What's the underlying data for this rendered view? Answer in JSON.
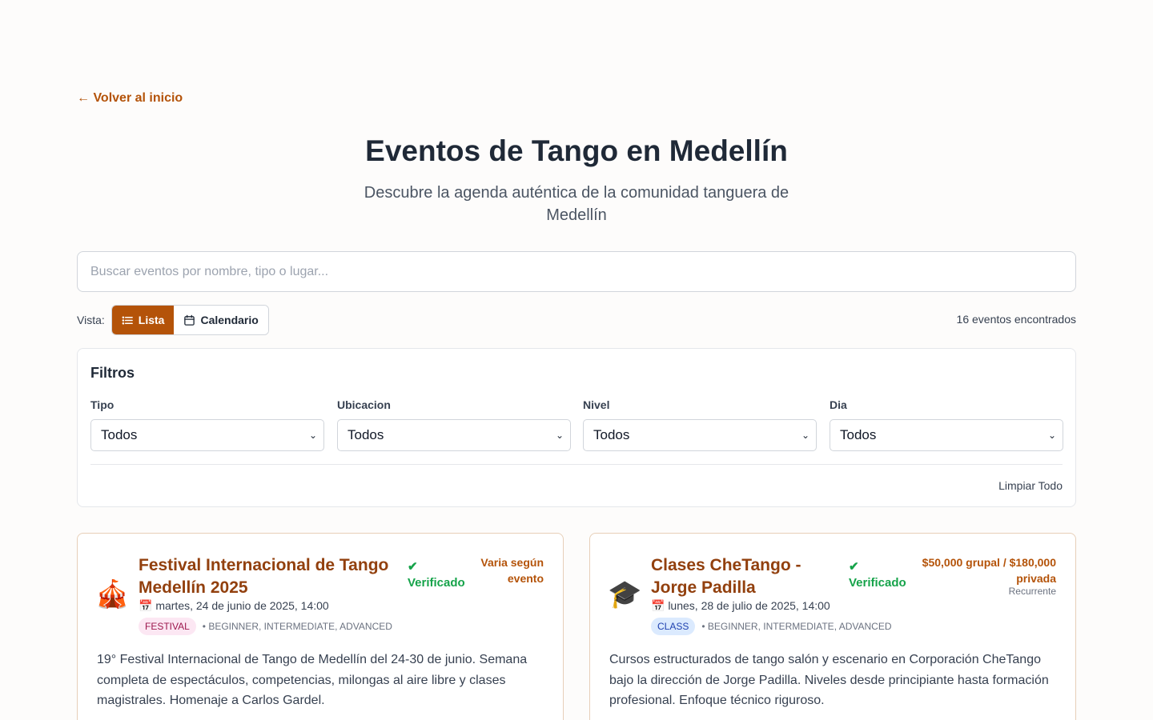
{
  "back_link": "← Volver al inicio",
  "page_title": "Eventos de Tango en Medellín",
  "page_subtitle": "Descubre la agenda auténtica de la comunidad tanguera de Medellín",
  "search": {
    "placeholder": "Buscar eventos por nombre, tipo o lugar..."
  },
  "view": {
    "label": "Vista:",
    "list_label": "Lista",
    "calendar_label": "Calendario",
    "active": "Lista"
  },
  "results_count": "16 eventos encontrados",
  "filters": {
    "title": "Filtros",
    "groups": [
      {
        "label": "Tipo",
        "value": "Todos"
      },
      {
        "label": "Ubicacion",
        "value": "Todos"
      },
      {
        "label": "Nivel",
        "value": "Todos"
      },
      {
        "label": "Dia",
        "value": "Todos"
      }
    ],
    "clear_label": "Limpiar Todo"
  },
  "events": [
    {
      "emoji": "🎪",
      "title": "Festival Internacional de Tango Medellín 2025",
      "verified": "✔ Verificado",
      "price": "Varia según evento",
      "recurrent": "",
      "date": "📅 martes, 24 de junio de 2025, 14:00",
      "type_badge": "FESTIVAL",
      "levels": "• BEGINNER, INTERMEDIATE, ADVANCED",
      "description": "19° Festival Internacional de Tango de Medellín del 24-30 de junio. Semana completa de espectáculos, competencias, milongas al aire libre y clases magistrales. Homenaje a Carlos Gardel."
    },
    {
      "emoji": "🎓",
      "title": "Clases CheTango - Jorge Padilla",
      "verified": "✔ Verificado",
      "price": "$50,000 grupal / $180,000 privada",
      "recurrent": "Recurrente",
      "date": "📅 lunes, 28 de julio de 2025, 14:00",
      "type_badge": "CLASS",
      "levels": "• BEGINNER, INTERMEDIATE, ADVANCED",
      "description": "Cursos estructurados de tango salón y escenario en Corporación CheTango bajo la dirección de Jorge Padilla. Niveles desde principiante hasta formación profesional. Enfoque técnico riguroso."
    }
  ],
  "colors": {
    "accent": "#b45309",
    "title_brown": "#92400e",
    "verified_green": "#16a34a",
    "background": "#fdfcfb"
  }
}
